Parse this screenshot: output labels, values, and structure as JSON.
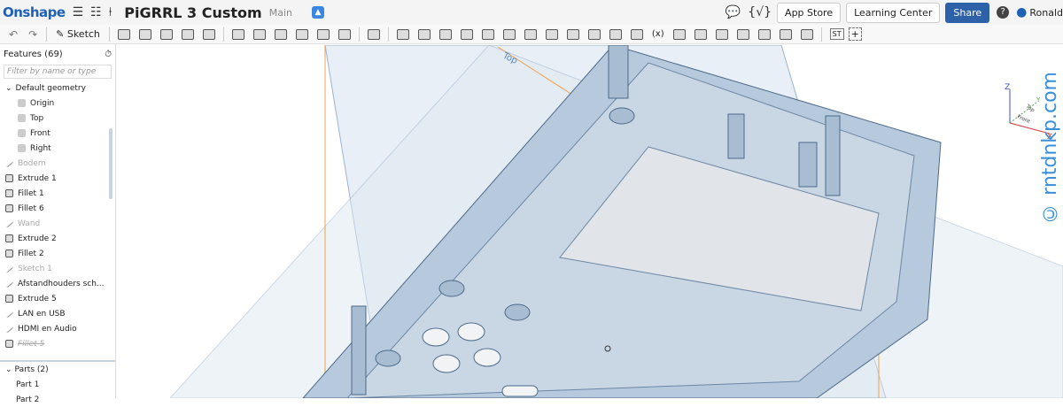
{
  "header": {
    "logo": "Onshape",
    "title": "PiGRRL 3 Custom",
    "branch": "Main",
    "app_store": "App Store",
    "learning_center": "Learning Center",
    "share": "Share",
    "user": "Ronald",
    "help": "?"
  },
  "toolbar": {
    "sketch": "Sketch",
    "st": "ST"
  },
  "features": {
    "title": "Features (69)",
    "filter_placeholder": "Filter by name or type",
    "items": [
      {
        "label": "Default geometry",
        "type": "group"
      },
      {
        "label": "Origin",
        "type": "sub"
      },
      {
        "label": "Top",
        "type": "sub"
      },
      {
        "label": "Front",
        "type": "sub"
      },
      {
        "label": "Right",
        "type": "sub"
      },
      {
        "label": "Bodem",
        "type": "sketch-dim"
      },
      {
        "label": "Extrude 1",
        "type": "feat"
      },
      {
        "label": "Fillet 1",
        "type": "feat"
      },
      {
        "label": "Fillet 6",
        "type": "feat"
      },
      {
        "label": "Wand",
        "type": "sketch-dim"
      },
      {
        "label": "Extrude 2",
        "type": "feat"
      },
      {
        "label": "Fillet 2",
        "type": "feat"
      },
      {
        "label": "Sketch 1",
        "type": "sketch-dim"
      },
      {
        "label": "Afstandhouders sch...",
        "type": "sketch"
      },
      {
        "label": "Extrude 5",
        "type": "feat"
      },
      {
        "label": "LAN en USB",
        "type": "sketch"
      },
      {
        "label": "HDMI en Audio",
        "type": "sketch"
      },
      {
        "label": "Fillet 5",
        "type": "suppressed"
      }
    ]
  },
  "parts": {
    "title": "Parts (2)",
    "items": [
      "Part 1",
      "Part 2"
    ]
  },
  "viewport": {
    "plane_label": "Top",
    "cube": {
      "top": "Top",
      "front": "Front",
      "x": "X",
      "y": "Y",
      "z": "Z"
    }
  },
  "watermark": "© rntdnkp.com"
}
